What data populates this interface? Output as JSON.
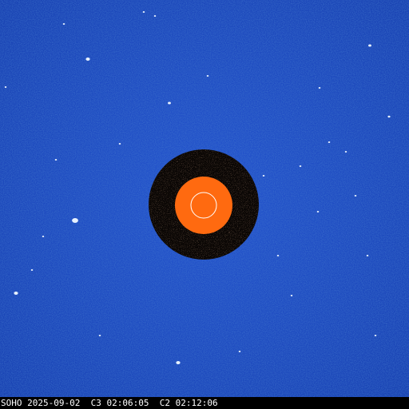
{
  "image": {
    "colors": {
      "background": "#1f4fc4",
      "occulter_ring": "#0a0604",
      "occulter_disk": "#ff6a10",
      "sun_outline": "#ffffff",
      "caption_bar": "#000000",
      "caption_text": "#ffffff"
    }
  },
  "caption": {
    "observatory": "SOHO",
    "date": "2025-09-02",
    "c3_label": "C3",
    "c3_time": "02:06:05",
    "c2_label": "C2",
    "c2_time": "02:12:06"
  }
}
